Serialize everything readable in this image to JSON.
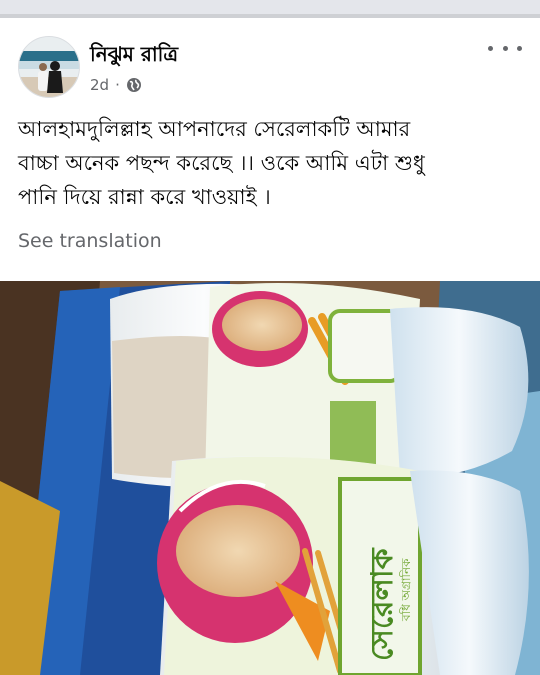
{
  "post": {
    "author_name": "নিঝুম রাত্রি",
    "time": "2d",
    "audience_icon": "globe-icon",
    "text_lines": [
      "আলহামদুলিল্লাহ আপনাদের সেরেলাকটি আমার",
      "বাচ্চা অনেক পছন্দ করেছে ।। ওকে আমি এটা শুধু",
      "পানি দিয়ে রান্না করে খাওয়াই ।"
    ],
    "translation_label": "See translation"
  },
  "photo": {
    "product_label": "সেরেলাক",
    "brand_label": "বধি অগ্রানিক"
  },
  "colors": {
    "secondary_text": "#65676b",
    "jar_lid_blue": "#dbe8f2",
    "label_green": "#7fb23c"
  }
}
